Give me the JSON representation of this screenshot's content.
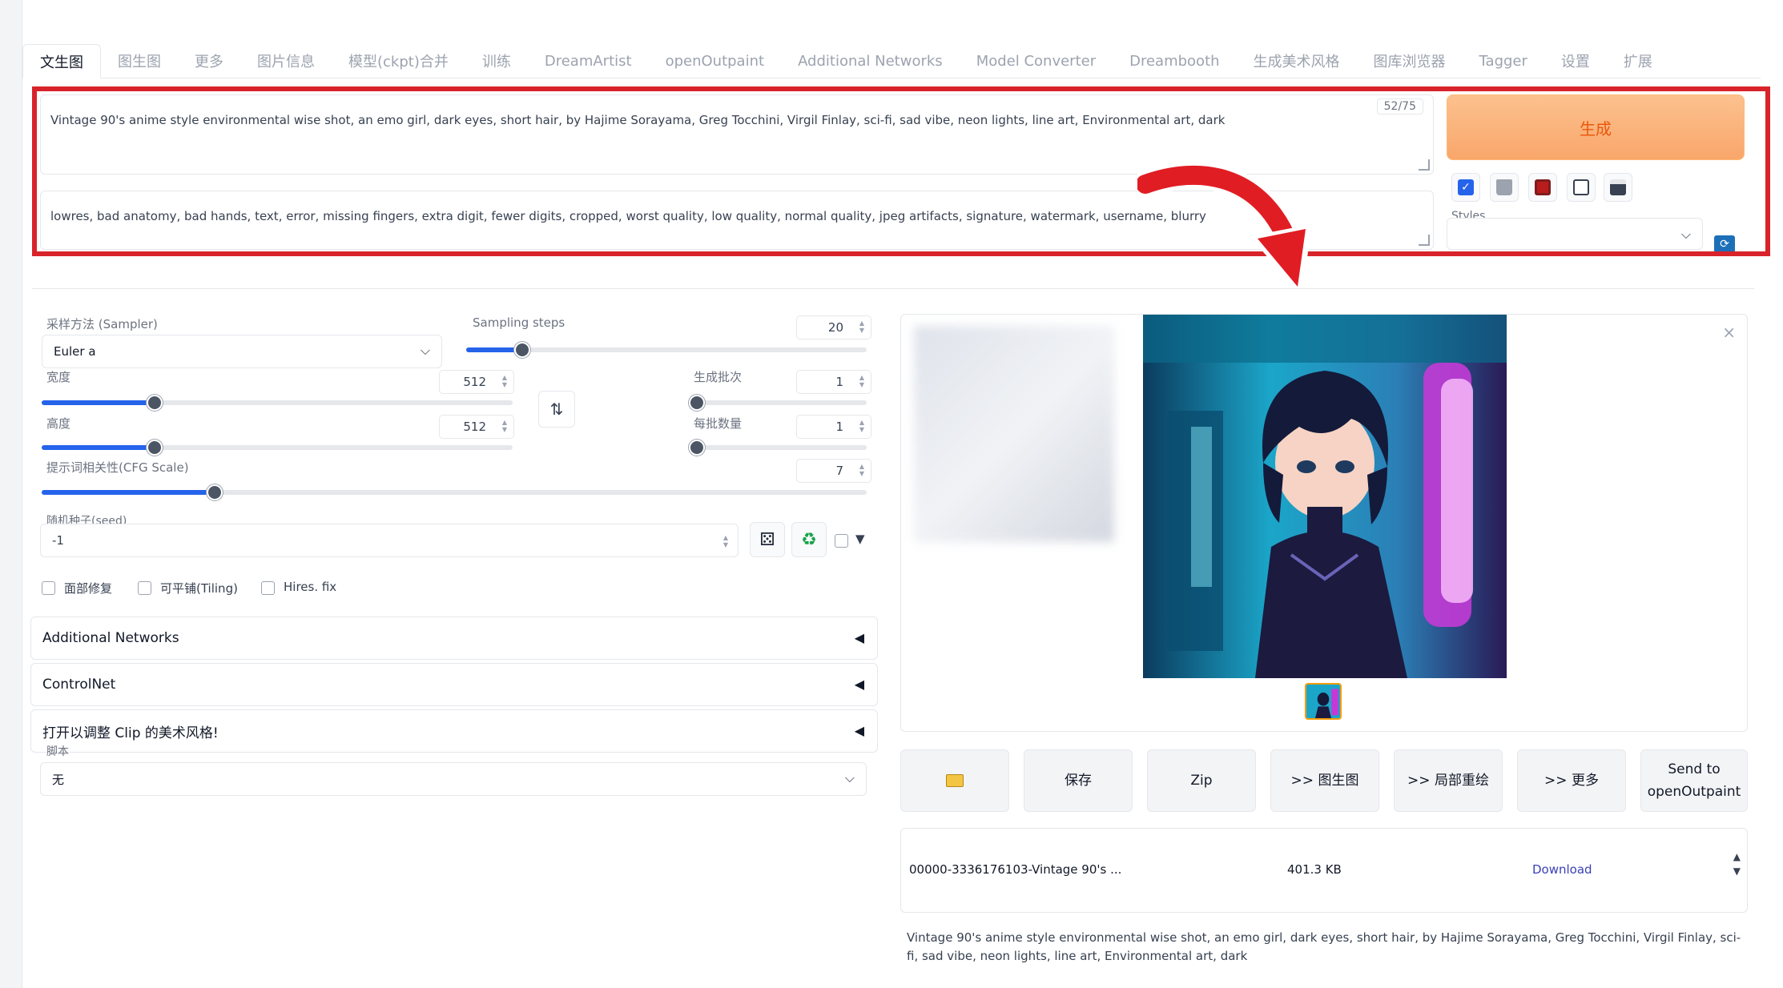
{
  "tabs": [
    "文生图",
    "图生图",
    "更多",
    "图片信息",
    "模型(ckpt)合并",
    "训练",
    "DreamArtist",
    "openOutpaint",
    "Additional Networks",
    "Model Converter",
    "Dreambooth",
    "生成美术风格",
    "图库浏览器",
    "Tagger",
    "设置",
    "扩展"
  ],
  "prompt": {
    "positive": "Vintage 90's anime style environmental wise shot, an emo girl, dark eyes, short hair, by Hajime Sorayama, Greg Tocchini, Virgil Finlay, sci-fi, sad vibe, neon lights, line art, Environmental art, dark",
    "token_count": "52/75",
    "negative": "lowres, bad anatomy, bad hands, text, error, missing fingers, extra digit, fewer digits, cropped, worst quality, low quality, normal quality, jpeg artifacts, signature, watermark, username, blurry"
  },
  "generate_label": "生成",
  "tool_icons": [
    "checkbox-icon",
    "trash-icon",
    "red-card-icon",
    "clipboard-icon",
    "save-icon"
  ],
  "styles": {
    "label": "Styles",
    "value": ""
  },
  "sampler": {
    "label": "采样方法 (Sampler)",
    "value": "Euler a"
  },
  "sampling_steps": {
    "label": "Sampling steps",
    "value": "20",
    "fraction": 0.14
  },
  "width": {
    "label": "宽度",
    "value": "512",
    "fraction": 0.24
  },
  "height": {
    "label": "高度",
    "value": "512",
    "fraction": 0.24
  },
  "batch_count": {
    "label": "生成批次",
    "value": "1",
    "fraction": 0.0
  },
  "batch_size": {
    "label": "每批数量",
    "value": "1",
    "fraction": 0.0
  },
  "cfg_scale": {
    "label": "提示词相关性(CFG Scale)",
    "value": "7",
    "fraction": 0.21
  },
  "seed": {
    "label": "随机种子(seed)",
    "value": "-1"
  },
  "checkboxes": [
    "面部修复",
    "可平铺(Tiling)",
    "Hires. fix"
  ],
  "accordions": [
    "Additional Networks",
    "ControlNet",
    "打开以调整 Clip 的美术风格!"
  ],
  "script": {
    "label": "脚本",
    "value": "无"
  },
  "actions": [
    "保存",
    "Zip",
    ">> 图生图",
    ">> 局部重绘",
    ">> 更多",
    "Send to openOutpaint"
  ],
  "file": {
    "name": "00000-3336176103-Vintage 90's ...",
    "size": "401.3 KB",
    "download": "Download"
  },
  "caption": "Vintage 90's anime style environmental wise shot, an emo girl, dark eyes, short hair, by Hajime Sorayama, Greg Tocchini, Virgil Finlay, sci-fi, sad vibe, neon lights, line art, Environmental art, dark",
  "colors": {
    "accent": "#2563eb",
    "highlight": "#d8232a",
    "generate": "#f9a66a"
  }
}
